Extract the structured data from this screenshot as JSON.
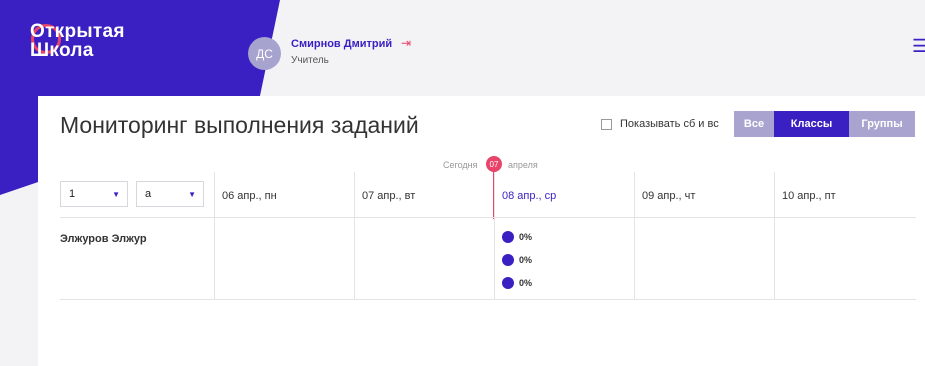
{
  "header": {
    "logo_line1": "Открытая",
    "logo_line2": "Школа",
    "avatar_initials": "ДС",
    "user_name": "Смирнов Дмитрий",
    "user_role": "Учитель",
    "logout_icon": "logout-icon",
    "menu_icon": "hamburger-icon"
  },
  "page": {
    "title": "Мониторинг выполнения заданий",
    "show_weekend_label": "Показывать сб и вс",
    "show_weekend_checked": false,
    "view_tabs": [
      "Все",
      "Классы",
      "Группы"
    ],
    "active_tab": "Классы"
  },
  "today": {
    "label": "Сегодня",
    "day": "07",
    "month": "апреля"
  },
  "filters": {
    "grade": "1",
    "letter": "а"
  },
  "days": [
    "06 апр., пн",
    "07 апр., вт",
    "08 апр., ср",
    "09 апр., чт",
    "10 апр., пт"
  ],
  "rows": [
    {
      "student": "Элжуров Элжур",
      "day_index": 2,
      "percents": [
        "0%",
        "0%",
        "0%"
      ]
    }
  ],
  "colors": {
    "brand": "#3a1fc2",
    "accent": "#e8446a",
    "tab_inactive": "#a8a4cf"
  }
}
